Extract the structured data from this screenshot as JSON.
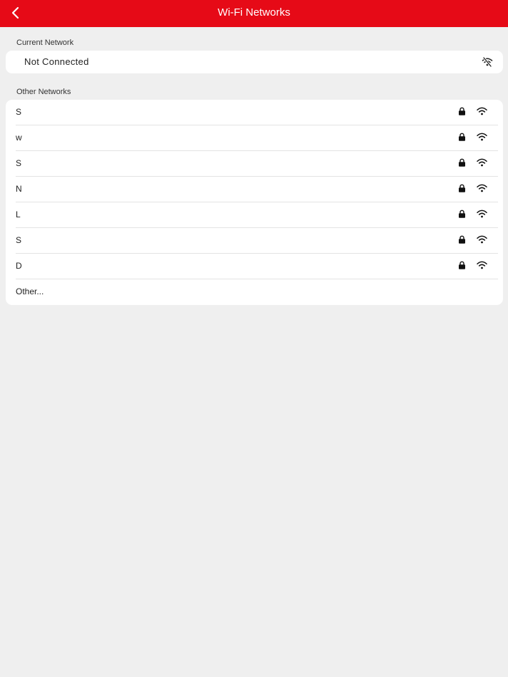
{
  "header": {
    "title": "Wi-Fi Networks",
    "back_icon": "chevron-left-icon"
  },
  "current": {
    "label": "Current Network",
    "status": "Not Connected",
    "icon": "wifi-off-icon"
  },
  "other": {
    "label": "Other Networks",
    "networks": [
      {
        "name": "S",
        "secured": true,
        "signal": "full"
      },
      {
        "name": "w",
        "secured": true,
        "signal": "full"
      },
      {
        "name": "S",
        "secured": true,
        "signal": "full"
      },
      {
        "name": "N",
        "secured": true,
        "signal": "full"
      },
      {
        "name": "L",
        "secured": true,
        "signal": "full"
      },
      {
        "name": "S",
        "secured": true,
        "signal": "full"
      },
      {
        "name": "D",
        "secured": true,
        "signal": "full"
      }
    ],
    "other_label": "Other..."
  },
  "colors": {
    "accent": "#e60a17",
    "background": "#efefef",
    "card": "#ffffff"
  }
}
